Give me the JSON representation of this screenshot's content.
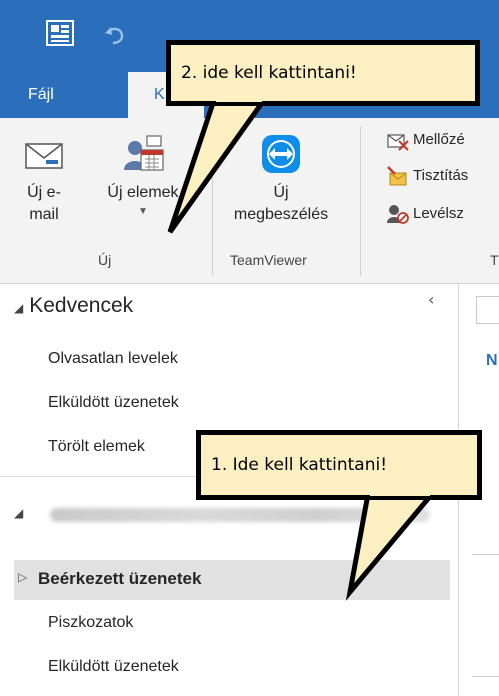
{
  "ribbon_tabs": {
    "file": "Fájl",
    "start_partial": "K"
  },
  "ribbon": {
    "new_mail": [
      "Új e-",
      "mail"
    ],
    "new_items": "Új elemek",
    "meeting": [
      "Új",
      "megbeszélés"
    ],
    "group_new": "Új",
    "group_teamviewer": "TeamViewer",
    "group_partial": "T",
    "commands": [
      "Mellőzé",
      "Tisztítás",
      "Levélsz"
    ]
  },
  "nav": {
    "favorites_header": "Kedvencek",
    "favorites": [
      "Olvasatlan levelek",
      "Elküldött üzenetek",
      "Törölt elemek"
    ],
    "inbox": "Beérkezett üzenetek",
    "folders": [
      "Piszkozatok",
      "Elküldött üzenetek"
    ],
    "collapse_glyph": "‹"
  },
  "right_pane": {
    "partial_letter": "N"
  },
  "callouts": {
    "step2": "2. ide kell kattintani!",
    "step1": "1. Ide kell kattintani!"
  },
  "colors": {
    "accent": "#2b6fba",
    "callout_fill": "#fcefc2",
    "selected_row": "#e1e1e1"
  }
}
